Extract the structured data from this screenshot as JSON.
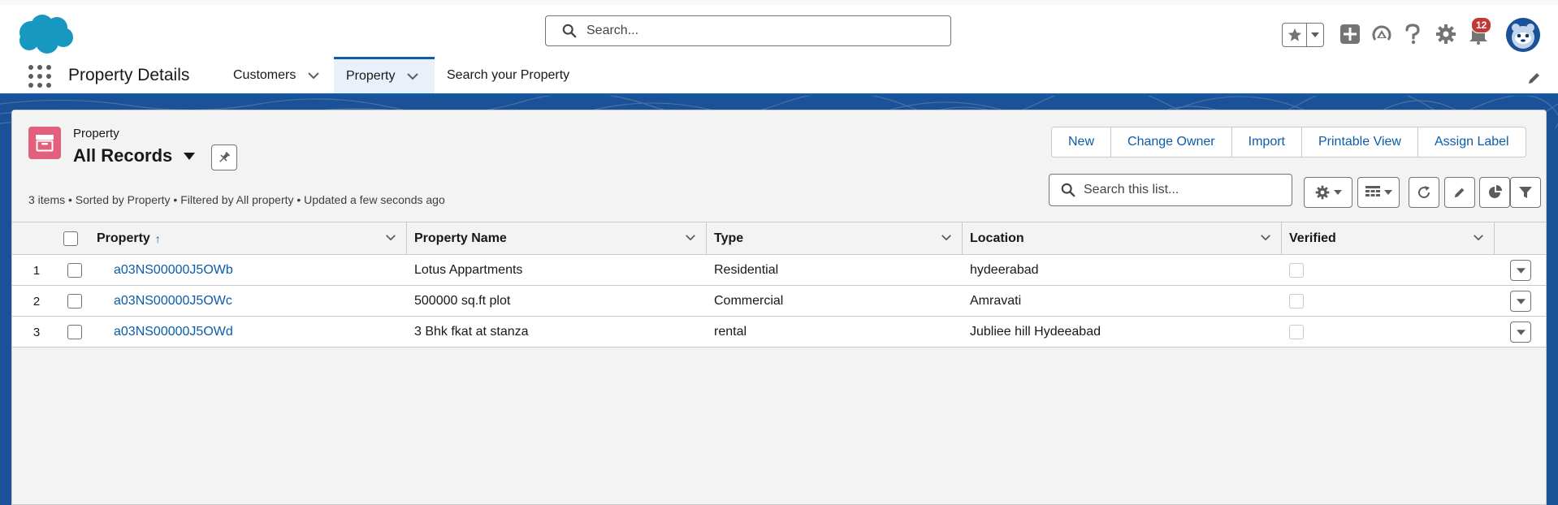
{
  "header": {
    "search_placeholder": "Search...",
    "notification_count": "12",
    "icons": [
      "salesforce-cloud-logo",
      "favorites-star-icon",
      "chevron-down-icon",
      "global-actions-plus-icon",
      "trailhead-icon",
      "help-icon",
      "setup-gear-icon",
      "notifications-bell-icon",
      "user-avatar"
    ]
  },
  "nav": {
    "app_name": "Property Details",
    "items": [
      {
        "label": "Customers",
        "has_menu": true,
        "active": false
      },
      {
        "label": "Property",
        "has_menu": true,
        "active": true
      },
      {
        "label": "Search your Property",
        "has_menu": false,
        "active": false
      }
    ]
  },
  "list_view": {
    "object_label": "Property",
    "view_name": "All Records",
    "actions": [
      "New",
      "Change Owner",
      "Import",
      "Printable View",
      "Assign Label"
    ],
    "meta": "3 items • Sorted by Property • Filtered by All property • Updated a few seconds ago",
    "search_placeholder": "Search this list...",
    "toolbar_icons": [
      "list-view-controls-gear-icon",
      "display-as-table-icon",
      "refresh-icon",
      "inline-edit-pencil-icon",
      "charts-icon",
      "filter-icon"
    ]
  },
  "table": {
    "columns": [
      "Property",
      "Property Name",
      "Type",
      "Location",
      "Verified"
    ],
    "sort_indicator": "↑",
    "rows": [
      {
        "num": "1",
        "property": "a03NS00000J5OWb",
        "name": "Lotus Appartments",
        "type": "Residential",
        "location": "hydeerabad",
        "verified": false
      },
      {
        "num": "2",
        "property": "a03NS00000J5OWc",
        "name": "500000 sq.ft plot",
        "type": "Commercial",
        "location": "Amravati",
        "verified": false
      },
      {
        "num": "3",
        "property": "a03NS00000J5OWd",
        "name": "3 Bhk fkat at stanza",
        "type": "rental",
        "location": "Jubliee hill Hydeeabad",
        "verified": false
      }
    ]
  },
  "colors": {
    "brand_blue": "#0b5cab",
    "band_blue": "#1b5297",
    "object_icon": "#e2607d",
    "badge_red": "#c23934"
  }
}
